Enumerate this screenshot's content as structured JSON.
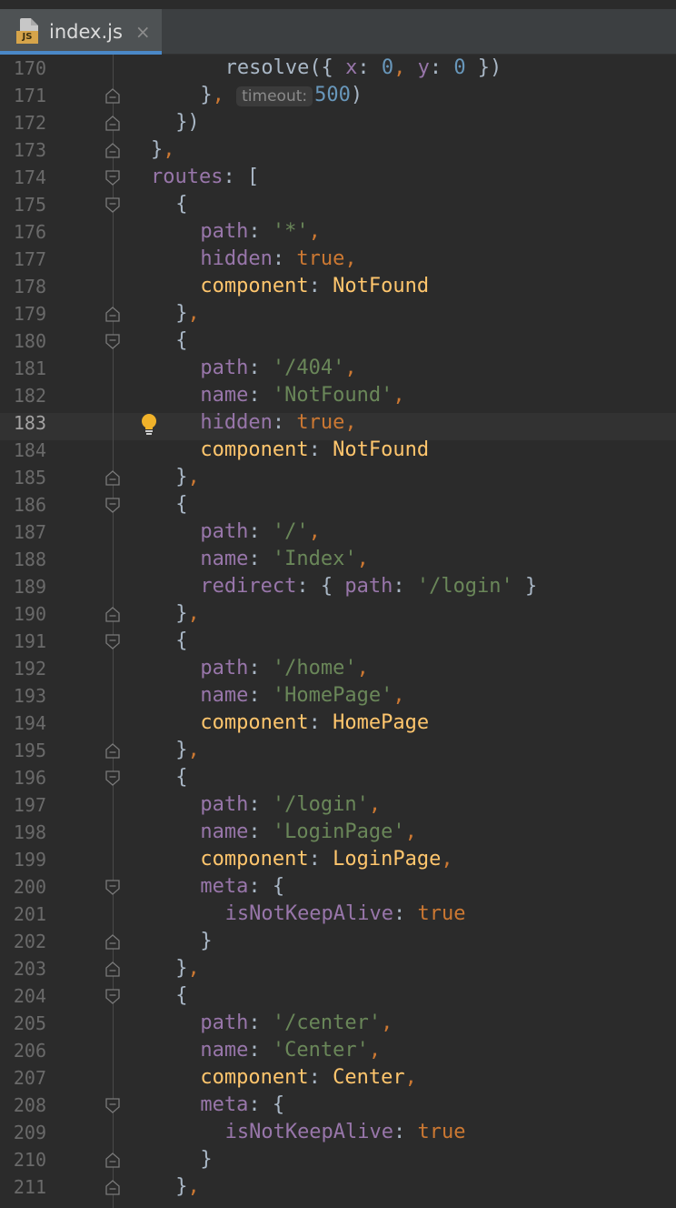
{
  "tab": {
    "filename": "index.js",
    "badge": "JS",
    "close_glyph": "×"
  },
  "editor": {
    "current_line": 183,
    "lines": [
      {
        "n": "170",
        "fold": "none",
        "indent": 3,
        "tokens": [
          [
            "plain",
            "resolve"
          ],
          [
            "plain",
            "({ "
          ],
          [
            "key",
            "x"
          ],
          [
            "plain",
            ": "
          ],
          [
            "num",
            "0"
          ],
          [
            "pun",
            ", "
          ],
          [
            "key",
            "y"
          ],
          [
            "plain",
            ": "
          ],
          [
            "num",
            "0"
          ],
          [
            "plain",
            " })"
          ]
        ]
      },
      {
        "n": "171",
        "fold": "end",
        "indent": 2,
        "tokens": [
          [
            "plain",
            "}"
          ],
          [
            "pun",
            ", "
          ],
          [
            "hint",
            "timeout:"
          ],
          [
            "num",
            "500"
          ],
          [
            "plain",
            ")"
          ]
        ]
      },
      {
        "n": "172",
        "fold": "end",
        "indent": 1,
        "tokens": [
          [
            "plain",
            "})"
          ]
        ]
      },
      {
        "n": "173",
        "fold": "end",
        "indent": 0,
        "tokens": [
          [
            "plain",
            "}"
          ],
          [
            "pun",
            ","
          ]
        ]
      },
      {
        "n": "174",
        "fold": "start",
        "indent": 0,
        "tokens": [
          [
            "key",
            "routes"
          ],
          [
            "plain",
            ": ["
          ]
        ]
      },
      {
        "n": "175",
        "fold": "start",
        "indent": 1,
        "tokens": [
          [
            "plain",
            "{"
          ]
        ]
      },
      {
        "n": "176",
        "fold": "none",
        "indent": 2,
        "tokens": [
          [
            "key",
            "path"
          ],
          [
            "plain",
            ": "
          ],
          [
            "str",
            "'*'"
          ],
          [
            "pun",
            ","
          ]
        ]
      },
      {
        "n": "177",
        "fold": "none",
        "indent": 2,
        "tokens": [
          [
            "key",
            "hidden"
          ],
          [
            "plain",
            ": "
          ],
          [
            "kw",
            "true"
          ],
          [
            "pun",
            ","
          ]
        ]
      },
      {
        "n": "178",
        "fold": "none",
        "indent": 2,
        "tokens": [
          [
            "cls",
            "component"
          ],
          [
            "plain",
            ": "
          ],
          [
            "cls",
            "NotFound"
          ]
        ]
      },
      {
        "n": "179",
        "fold": "end",
        "indent": 1,
        "tokens": [
          [
            "plain",
            "}"
          ],
          [
            "pun",
            ","
          ]
        ]
      },
      {
        "n": "180",
        "fold": "start",
        "indent": 1,
        "tokens": [
          [
            "plain",
            "{"
          ]
        ]
      },
      {
        "n": "181",
        "fold": "none",
        "indent": 2,
        "tokens": [
          [
            "key",
            "path"
          ],
          [
            "plain",
            ": "
          ],
          [
            "str",
            "'/404'"
          ],
          [
            "pun",
            ","
          ]
        ]
      },
      {
        "n": "182",
        "fold": "none",
        "indent": 2,
        "tokens": [
          [
            "key",
            "name"
          ],
          [
            "plain",
            ": "
          ],
          [
            "str",
            "'NotFound'"
          ],
          [
            "pun",
            ","
          ]
        ]
      },
      {
        "n": "183",
        "fold": "none",
        "indent": 2,
        "bulb": true,
        "tokens": [
          [
            "key",
            "hidden"
          ],
          [
            "plain",
            ": "
          ],
          [
            "kw",
            "true"
          ],
          [
            "pun",
            ","
          ]
        ]
      },
      {
        "n": "184",
        "fold": "none",
        "indent": 2,
        "tokens": [
          [
            "cls",
            "component"
          ],
          [
            "plain",
            ": "
          ],
          [
            "cls",
            "NotFound"
          ]
        ]
      },
      {
        "n": "185",
        "fold": "end",
        "indent": 1,
        "tokens": [
          [
            "plain",
            "}"
          ],
          [
            "pun",
            ","
          ]
        ]
      },
      {
        "n": "186",
        "fold": "start",
        "indent": 1,
        "tokens": [
          [
            "plain",
            "{"
          ]
        ]
      },
      {
        "n": "187",
        "fold": "none",
        "indent": 2,
        "tokens": [
          [
            "key",
            "path"
          ],
          [
            "plain",
            ": "
          ],
          [
            "str",
            "'/'"
          ],
          [
            "pun",
            ","
          ]
        ]
      },
      {
        "n": "188",
        "fold": "none",
        "indent": 2,
        "tokens": [
          [
            "key",
            "name"
          ],
          [
            "plain",
            ": "
          ],
          [
            "str",
            "'Index'"
          ],
          [
            "pun",
            ","
          ]
        ]
      },
      {
        "n": "189",
        "fold": "none",
        "indent": 2,
        "tokens": [
          [
            "key",
            "redirect"
          ],
          [
            "plain",
            ": { "
          ],
          [
            "key",
            "path"
          ],
          [
            "plain",
            ": "
          ],
          [
            "str",
            "'/login'"
          ],
          [
            "plain",
            " }"
          ]
        ]
      },
      {
        "n": "190",
        "fold": "end",
        "indent": 1,
        "tokens": [
          [
            "plain",
            "}"
          ],
          [
            "pun",
            ","
          ]
        ]
      },
      {
        "n": "191",
        "fold": "start",
        "indent": 1,
        "tokens": [
          [
            "plain",
            "{"
          ]
        ]
      },
      {
        "n": "192",
        "fold": "none",
        "indent": 2,
        "tokens": [
          [
            "key",
            "path"
          ],
          [
            "plain",
            ": "
          ],
          [
            "str",
            "'/home'"
          ],
          [
            "pun",
            ","
          ]
        ]
      },
      {
        "n": "193",
        "fold": "none",
        "indent": 2,
        "tokens": [
          [
            "key",
            "name"
          ],
          [
            "plain",
            ": "
          ],
          [
            "str",
            "'HomePage'"
          ],
          [
            "pun",
            ","
          ]
        ]
      },
      {
        "n": "194",
        "fold": "none",
        "indent": 2,
        "tokens": [
          [
            "cls",
            "component"
          ],
          [
            "plain",
            ": "
          ],
          [
            "cls",
            "HomePage"
          ]
        ]
      },
      {
        "n": "195",
        "fold": "end",
        "indent": 1,
        "tokens": [
          [
            "plain",
            "}"
          ],
          [
            "pun",
            ","
          ]
        ]
      },
      {
        "n": "196",
        "fold": "start",
        "indent": 1,
        "tokens": [
          [
            "plain",
            "{"
          ]
        ]
      },
      {
        "n": "197",
        "fold": "none",
        "indent": 2,
        "tokens": [
          [
            "key",
            "path"
          ],
          [
            "plain",
            ": "
          ],
          [
            "str",
            "'/login'"
          ],
          [
            "pun",
            ","
          ]
        ]
      },
      {
        "n": "198",
        "fold": "none",
        "indent": 2,
        "tokens": [
          [
            "key",
            "name"
          ],
          [
            "plain",
            ": "
          ],
          [
            "str",
            "'LoginPage'"
          ],
          [
            "pun",
            ","
          ]
        ]
      },
      {
        "n": "199",
        "fold": "none",
        "indent": 2,
        "tokens": [
          [
            "cls",
            "component"
          ],
          [
            "plain",
            ": "
          ],
          [
            "cls",
            "LoginPage"
          ],
          [
            "pun",
            ","
          ]
        ]
      },
      {
        "n": "200",
        "fold": "start",
        "indent": 2,
        "tokens": [
          [
            "key",
            "meta"
          ],
          [
            "plain",
            ": {"
          ]
        ]
      },
      {
        "n": "201",
        "fold": "none",
        "indent": 3,
        "tokens": [
          [
            "key",
            "isNotKeepAlive"
          ],
          [
            "plain",
            ": "
          ],
          [
            "kw",
            "true"
          ]
        ]
      },
      {
        "n": "202",
        "fold": "end",
        "indent": 2,
        "tokens": [
          [
            "plain",
            "}"
          ]
        ]
      },
      {
        "n": "203",
        "fold": "end",
        "indent": 1,
        "tokens": [
          [
            "plain",
            "}"
          ],
          [
            "pun",
            ","
          ]
        ]
      },
      {
        "n": "204",
        "fold": "start",
        "indent": 1,
        "tokens": [
          [
            "plain",
            "{"
          ]
        ]
      },
      {
        "n": "205",
        "fold": "none",
        "indent": 2,
        "tokens": [
          [
            "key",
            "path"
          ],
          [
            "plain",
            ": "
          ],
          [
            "str",
            "'/center'"
          ],
          [
            "pun",
            ","
          ]
        ]
      },
      {
        "n": "206",
        "fold": "none",
        "indent": 2,
        "tokens": [
          [
            "key",
            "name"
          ],
          [
            "plain",
            ": "
          ],
          [
            "str",
            "'Center'"
          ],
          [
            "pun",
            ","
          ]
        ]
      },
      {
        "n": "207",
        "fold": "none",
        "indent": 2,
        "tokens": [
          [
            "cls",
            "component"
          ],
          [
            "plain",
            ": "
          ],
          [
            "cls",
            "Center"
          ],
          [
            "pun",
            ","
          ]
        ]
      },
      {
        "n": "208",
        "fold": "start",
        "indent": 2,
        "tokens": [
          [
            "key",
            "meta"
          ],
          [
            "plain",
            ": {"
          ]
        ]
      },
      {
        "n": "209",
        "fold": "none",
        "indent": 3,
        "tokens": [
          [
            "key",
            "isNotKeepAlive"
          ],
          [
            "plain",
            ": "
          ],
          [
            "kw",
            "true"
          ]
        ]
      },
      {
        "n": "210",
        "fold": "end",
        "indent": 2,
        "tokens": [
          [
            "plain",
            "}"
          ]
        ]
      },
      {
        "n": "211",
        "fold": "end",
        "indent": 1,
        "tokens": [
          [
            "plain",
            "}"
          ],
          [
            "pun",
            ","
          ]
        ]
      }
    ]
  }
}
